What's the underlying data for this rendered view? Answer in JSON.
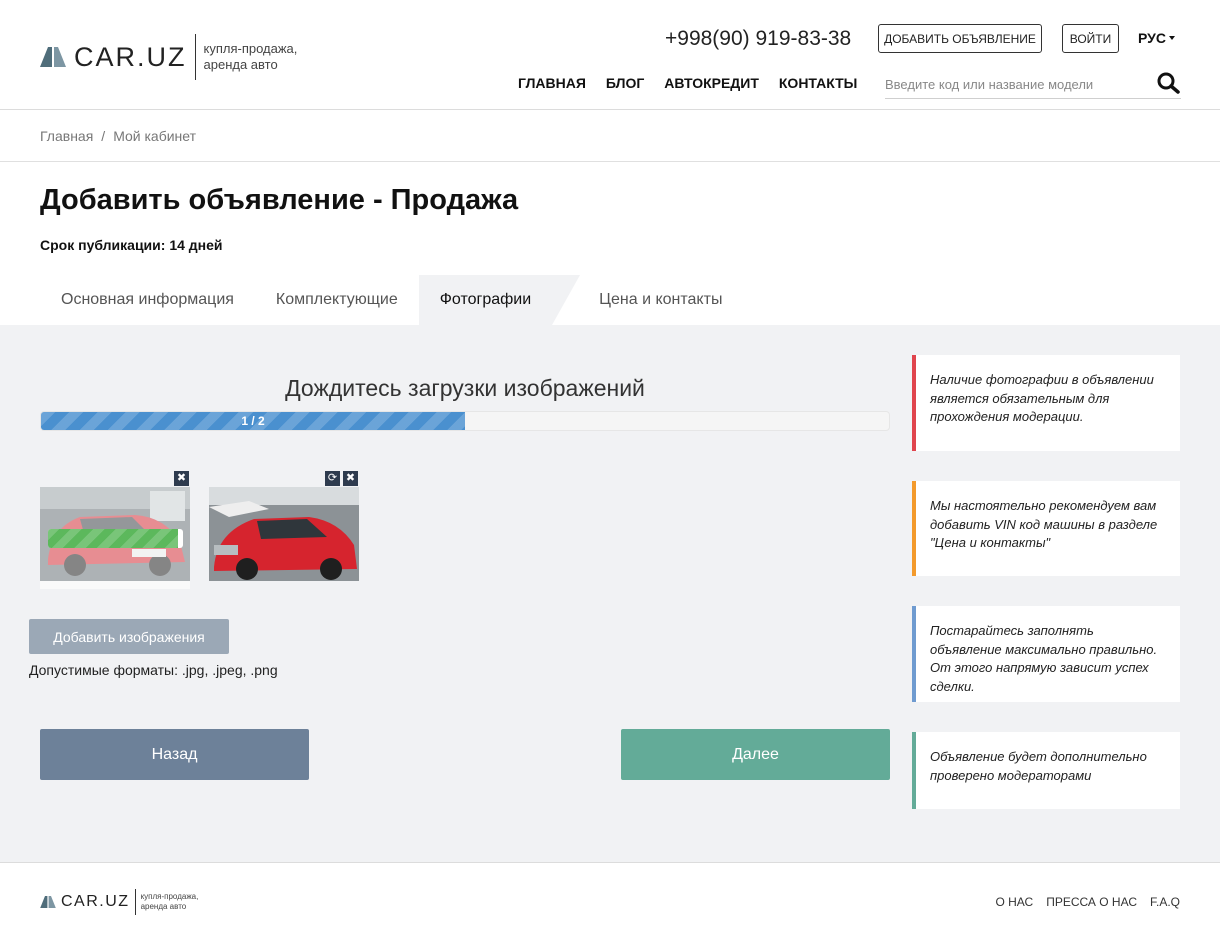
{
  "header": {
    "logo_text": "CAR.UZ",
    "tagline": "купля-продажа, аренда авто",
    "phone": "+998(90) 919-83-38",
    "add_ad_label": "ДОБАВИТЬ ОБЪЯВЛЕНИЕ",
    "login_label": "ВОЙТИ",
    "language": "РУС",
    "nav": [
      "ГЛАВНАЯ",
      "БЛОГ",
      "АВТОКРЕДИТ",
      "КОНТАКТЫ"
    ],
    "search_placeholder": "Введите код или название модели"
  },
  "breadcrumb": {
    "items": [
      "Главная",
      "Мой кабинет"
    ],
    "separator": "/"
  },
  "page": {
    "title": "Добавить объявление - Продажа",
    "publication_term": "Срок публикации: 14 дней"
  },
  "tabs": [
    {
      "label": "Основная информация",
      "active": false
    },
    {
      "label": "Комплектующие",
      "active": false
    },
    {
      "label": "Фотографии",
      "active": true
    },
    {
      "label": "Цена и контакты",
      "active": false
    }
  ],
  "upload": {
    "heading": "Дождитесь загрузки изображений",
    "progress_text": "1 / 2",
    "progress_fraction": 0.5,
    "thumb1_progress_fraction": 0.96,
    "add_images_label": "Добавить изображения",
    "formats_text": "Допустимые форматы: .jpg, .jpeg, .png"
  },
  "actions": {
    "back_label": "Назад",
    "next_label": "Далее"
  },
  "notes": [
    {
      "text": "Наличие фотографии в объявлении является обязательным для прохождения модерации.",
      "color": "#e0454d"
    },
    {
      "text": "Мы настоятельно рекомендуем вам добавить VIN код машины в разделе \"Цена и контакты\"",
      "color": "#f39a2c"
    },
    {
      "text": "Постарайтесь заполнять объявление максимально правильно. От этого напрямую зависит успех сделки.",
      "color": "#6f9bd0"
    },
    {
      "text": "Объявление будет дополнительно проверено модераторами",
      "color": "#63ab98"
    }
  ],
  "footer": {
    "logo_text": "CAR.UZ",
    "tagline": "купля-продажа, аренда авто",
    "links": [
      "О НАС",
      "ПРЕССА О НАС",
      "F.A.Q"
    ]
  },
  "colors": {
    "progress_blue": "#4a90cf",
    "progress_green": "#5cb85c",
    "back_button": "#6d8199",
    "next_button": "#63ab98",
    "logo_mark": "#4f6d7a"
  }
}
